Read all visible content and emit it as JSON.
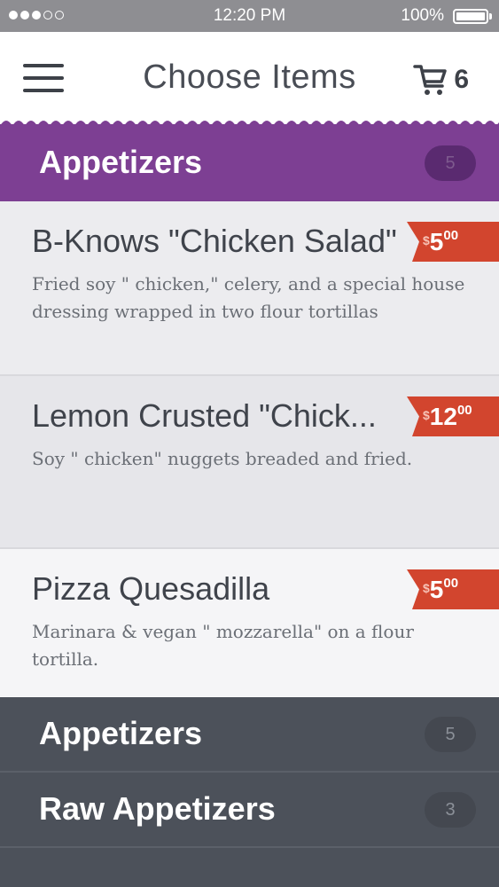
{
  "status_bar": {
    "time": "12:20 PM",
    "battery": "100%",
    "signal_bars_filled": 3,
    "signal_bars_total": 5
  },
  "header": {
    "title": "Choose Items",
    "cart_count": "6"
  },
  "current_category": {
    "title": "Appetizers",
    "count": "5"
  },
  "items": [
    {
      "name": "B-Knows \"Chicken Salad\"",
      "description": "Fried soy \" chicken,\"  celery, and a special house dressing wrapped in two flour tortillas",
      "price": {
        "currency": "$",
        "whole": "5",
        "cents": "00"
      }
    },
    {
      "name": "Lemon Crusted \"Chick...",
      "description": "Soy \" chicken\"  nuggets breaded and fried.",
      "price": {
        "currency": "$",
        "whole": "12",
        "cents": "00"
      }
    },
    {
      "name": "Pizza Quesadilla",
      "description": "Marinara & vegan \" mozzarella\"  on a flour tortilla.",
      "price": {
        "currency": "$",
        "whole": "5",
        "cents": "00"
      }
    }
  ],
  "categories": [
    {
      "name": "Appetizers",
      "count": "5"
    },
    {
      "name": "Raw Appetizers",
      "count": "3"
    }
  ],
  "colors": {
    "accent_purple": "#7d3f93",
    "price_red": "#d2452e",
    "dark_panel": "#4c515a"
  }
}
